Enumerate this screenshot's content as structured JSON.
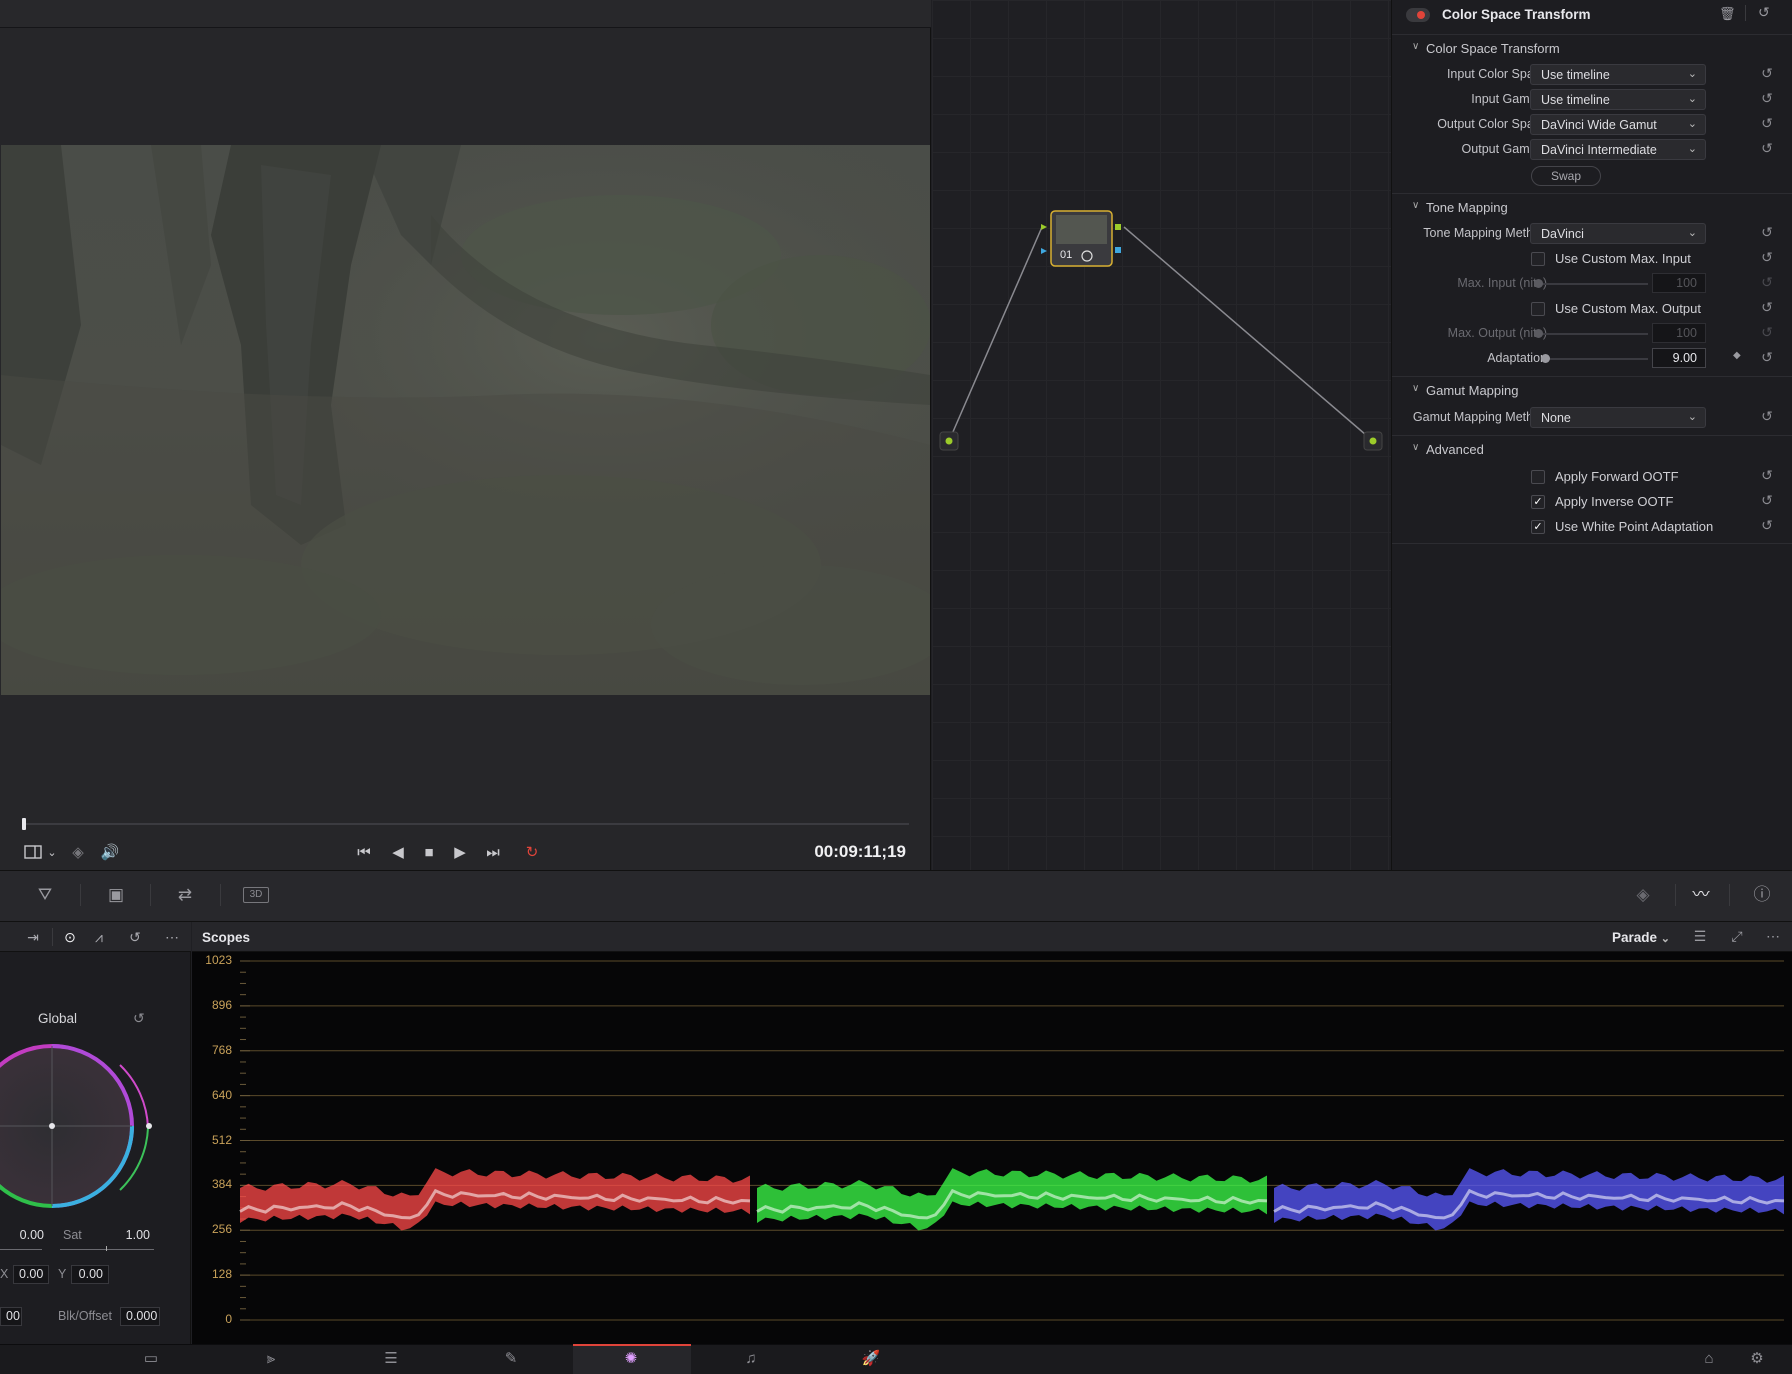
{
  "viewer": {
    "timecode": "00:09:11;19"
  },
  "node_editor": {
    "node_label": "01"
  },
  "inspector": {
    "title": "Color Space Transform",
    "sections": {
      "cst": "Color Space Transform",
      "tone": "Tone Mapping",
      "gamut": "Gamut Mapping",
      "advanced": "Advanced"
    },
    "input_color_space": {
      "label": "Input Color Space",
      "value": "Use timeline"
    },
    "input_gamma": {
      "label": "Input Gamma",
      "value": "Use timeline"
    },
    "output_color_space": {
      "label": "Output Color Space",
      "value": "DaVinci Wide Gamut"
    },
    "output_gamma": {
      "label": "Output Gamma",
      "value": "DaVinci Intermediate"
    },
    "swap_label": "Swap",
    "tone_mapping_method": {
      "label": "Tone Mapping Method",
      "value": "DaVinci"
    },
    "use_custom_max_input": {
      "label": "Use Custom Max. Input",
      "checked": false
    },
    "max_input": {
      "label": "Max. Input (nits)",
      "value": "100"
    },
    "use_custom_max_output": {
      "label": "Use Custom Max. Output",
      "checked": false
    },
    "max_output": {
      "label": "Max. Output (nits)",
      "value": "100"
    },
    "adaptation": {
      "label": "Adaptation",
      "value": "9.00"
    },
    "gamut_mapping_method": {
      "label": "Gamut Mapping Method",
      "value": "None"
    },
    "apply_forward_ootf": {
      "label": "Apply Forward OOTF",
      "checked": false
    },
    "apply_inverse_ootf": {
      "label": "Apply Inverse OOTF",
      "checked": true
    },
    "use_white_point_adaptation": {
      "label": "Use White Point Adaptation",
      "checked": true
    }
  },
  "palette_toolbar": {
    "three_d_label": "3D"
  },
  "color_wheel": {
    "title": "Global",
    "hue_value": "0.00",
    "sat_label": "Sat",
    "sat_value": "1.00",
    "x_label": "X",
    "x_value": "0.00",
    "y_label": "Y",
    "y_value": "0.00",
    "left_value": "00",
    "blk_offset_label": "Blk/Offset",
    "blk_offset_value": "0.000"
  },
  "scopes": {
    "title": "Scopes",
    "mode": "Parade",
    "y_axis_labels": [
      "1023",
      "896",
      "768",
      "640",
      "512",
      "384",
      "256",
      "128",
      "0"
    ],
    "channel_colors": {
      "red": "#ff4a4a",
      "green": "#3cff4a",
      "blue": "#5a5aff"
    }
  },
  "colors": {
    "accent_loop": "#e0443a",
    "node_border": "#d8b032",
    "active_page": "#e0443a"
  }
}
